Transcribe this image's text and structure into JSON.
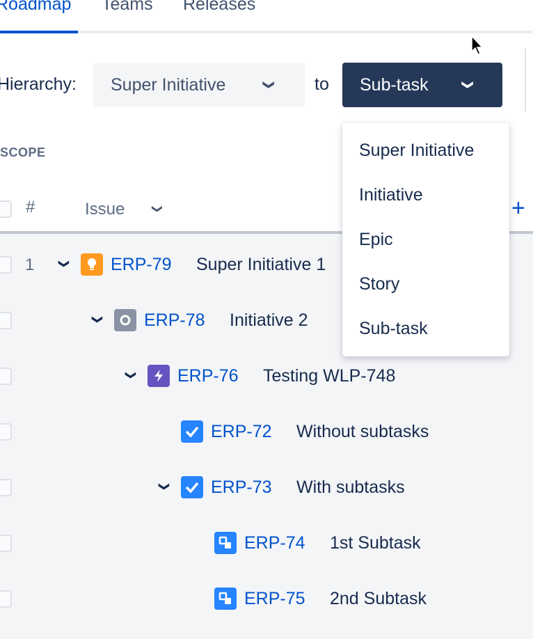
{
  "tabs": [
    {
      "label": "Roadmap",
      "active": true
    },
    {
      "label": "Teams"
    },
    {
      "label": "Releases"
    }
  ],
  "hierarchy": {
    "label": "Hierarchy:",
    "from": "Super Initiative",
    "to_label": "to",
    "to": "Sub-task"
  },
  "dropdown": {
    "options": [
      "Super Initiative",
      "Initiative",
      "Epic",
      "Story",
      "Sub-task"
    ]
  },
  "scope": {
    "title": "SCOPE",
    "col_number": "#",
    "col_issue": "Issue",
    "add": "+"
  },
  "rows": [
    {
      "number": "1",
      "key": "ERP-79",
      "summary": "Super Initiative 1",
      "type": "super-initiative"
    },
    {
      "number": "",
      "key": "ERP-78",
      "summary": "Initiative 2",
      "type": "initiative"
    },
    {
      "number": "",
      "key": "ERP-76",
      "summary": "Testing WLP-748",
      "type": "epic"
    },
    {
      "number": "",
      "key": "ERP-72",
      "summary": "Without subtasks",
      "type": "story"
    },
    {
      "number": "",
      "key": "ERP-73",
      "summary": "With subtasks",
      "type": "story"
    },
    {
      "number": "",
      "key": "ERP-74",
      "summary": "1st Subtask",
      "type": "subtask"
    },
    {
      "number": "",
      "key": "ERP-75",
      "summary": "2nd Subtask",
      "type": "subtask"
    }
  ],
  "colors": {
    "accent": "#0052cc",
    "dark": "#253858",
    "super": "#ff991f",
    "initiative": "#8993a4",
    "epic": "#6554c0",
    "story": "#2684ff"
  }
}
